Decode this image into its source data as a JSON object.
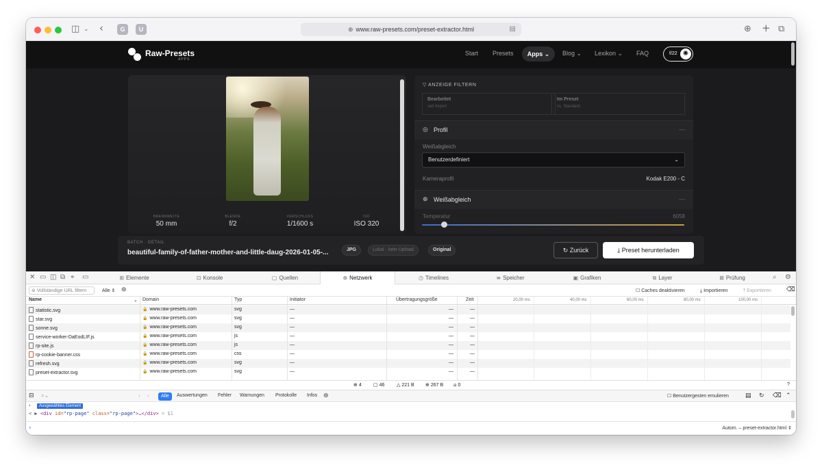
{
  "browser": {
    "url": "www.raw-presets.com/preset-extractor.html",
    "favicons": [
      "G",
      "U"
    ]
  },
  "site": {
    "logo": {
      "name": "Raw-Presets",
      "sub": "APPS"
    },
    "nav": [
      "Start",
      "Presets",
      "Apps",
      "Blog",
      "Lexikon",
      "FAQ"
    ],
    "badge": "f/22",
    "exif": [
      {
        "label": "BRENNWEITE",
        "value": "50 mm"
      },
      {
        "label": "BLENDE",
        "value": "f/2"
      },
      {
        "label": "VERSCHLUSS",
        "value": "1/1600 s"
      },
      {
        "label": "ISO",
        "value": "ISO 320"
      }
    ],
    "filter": {
      "heading": "ANZEIGE FILTERN",
      "cells": [
        {
          "title": "Bearbeitet",
          "sub": "seit Import"
        },
        {
          "title": "Im Preset",
          "sub": "vs. Standard"
        }
      ],
      "profile_title": "Profil",
      "wb_label": "Weißabgleich",
      "wb_value": "Benutzerdefiniert",
      "camera_label": "Kameraprofil",
      "camera_value": "Kodak E200 - C",
      "wb_section": "Weißabgleich",
      "temp_label": "Temperatur",
      "temp_value": "6058",
      "collapse_symbol": "—"
    },
    "batch": {
      "label": "BATCH · DETAIL",
      "filename": "beautiful-family-of-father-mother-and-little-daug-2026-01-05-...",
      "pills": [
        "JPG",
        "Lokal · kein Upload",
        "Original"
      ],
      "back": "Zurück",
      "download": "Preset herunterladen"
    }
  },
  "devtools": {
    "tabs": [
      "Elemente",
      "Konsole",
      "Quellen",
      "Netzwerk",
      "Timelines",
      "Speicher",
      "Grafiken",
      "Layer",
      "Prüfung"
    ],
    "active_tab": "Netzwerk",
    "filter_placeholder": "Vollständige URL filtern",
    "type_filter": "Alle",
    "caches": "Caches deaktivieren",
    "import": "Importieren",
    "export": "Exportieren",
    "columns": [
      "Name",
      "Domain",
      "Typ",
      "Initiator",
      "Übertragungsgröße",
      "Zeit"
    ],
    "ticks": [
      "20,00 ms",
      "40,00 ms",
      "60,00 ms",
      "80,00 ms",
      "100,00 ms"
    ],
    "rows": [
      {
        "name": "statistic.svg",
        "domain": "www.raw-presets.com",
        "type": "svg",
        "initiator": "—",
        "size": "—",
        "time": "—"
      },
      {
        "name": "star.svg",
        "domain": "www.raw-presets.com",
        "type": "svg",
        "initiator": "—",
        "size": "—",
        "time": "—"
      },
      {
        "name": "sonne.svg",
        "domain": "www.raw-presets.com",
        "type": "svg",
        "initiator": "—",
        "size": "—",
        "time": "—"
      },
      {
        "name": "service-worker-DaEodLIF.js",
        "domain": "www.raw-presets.com",
        "type": "js",
        "initiator": "—",
        "size": "—",
        "time": "—"
      },
      {
        "name": "rp-site.js",
        "domain": "www.raw-presets.com",
        "type": "js",
        "initiator": "—",
        "size": "—",
        "time": "—"
      },
      {
        "name": "rp-cookie-banner.css",
        "domain": "www.raw-presets.com",
        "type": "css",
        "initiator": "—",
        "size": "—",
        "time": "—"
      },
      {
        "name": "refresh.svg",
        "domain": "www.raw-presets.com",
        "type": "svg",
        "initiator": "—",
        "size": "—",
        "time": "—"
      },
      {
        "name": "preset-extractor.svg",
        "domain": "www.raw-presets.com",
        "type": "svg",
        "initiator": "—",
        "size": "—",
        "time": "—"
      }
    ],
    "summary": {
      "requests": "4",
      "resources": "46",
      "transferred": "221 B",
      "size": "267 B",
      "time": "0",
      "help": "?"
    },
    "console": {
      "filters": [
        "Alle",
        "Auswertungen",
        "Fehler",
        "Warnungen",
        "Protokolle",
        "Infos"
      ],
      "emulate": "Benutzergesten emulieren",
      "selected_badge": "Ausgewähltes Element",
      "line_prefix": "< ▶",
      "line_tag_open": "<div",
      "line_attr_id": "id=",
      "line_val_id": "\"rp-page\"",
      "line_attr_class": "class=",
      "line_val_class": "\"rp-page\"",
      "line_rest": ">…</div>",
      "line_ref": "= $1",
      "context": "Autom. – preset-extractor.html"
    }
  }
}
